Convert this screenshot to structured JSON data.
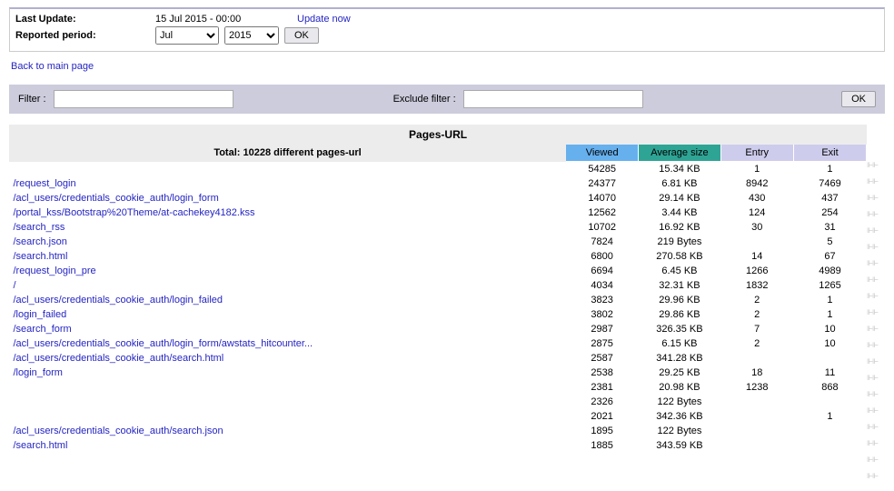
{
  "top": {
    "last_update_label": "Last Update:",
    "last_update_value": "15 Jul 2015 - 00:00",
    "update_now": "Update now",
    "reported_label": "Reported period:",
    "month": "Jul",
    "year": "2015",
    "ok": "OK"
  },
  "back_link": "Back to main page",
  "filter": {
    "filter_label": "Filter :",
    "exclude_label": "Exclude filter :",
    "ok": "OK"
  },
  "table": {
    "title": "Pages-URL",
    "total": "Total: 10228 different pages-url",
    "headers": {
      "viewed": "Viewed",
      "avg": "Average size",
      "entry": "Entry",
      "exit": "Exit"
    },
    "rows": [
      {
        "url": "",
        "viewed": "54285",
        "avg": "15.34 KB",
        "entry": "1",
        "exit": "1"
      },
      {
        "url": "/request_login",
        "viewed": "24377",
        "avg": "6.81 KB",
        "entry": "8942",
        "exit": "7469"
      },
      {
        "url": "/acl_users/credentials_cookie_auth/login_form",
        "viewed": "14070",
        "avg": "29.14 KB",
        "entry": "430",
        "exit": "437"
      },
      {
        "url": "/portal_kss/Bootstrap%20Theme/at-cachekey4182.kss",
        "viewed": "12562",
        "avg": "3.44 KB",
        "entry": "124",
        "exit": "254"
      },
      {
        "url": "/search_rss",
        "viewed": "10702",
        "avg": "16.92 KB",
        "entry": "30",
        "exit": "31"
      },
      {
        "url": "/search.json",
        "viewed": "7824",
        "avg": "219 Bytes",
        "entry": "",
        "exit": "5"
      },
      {
        "url": "/search.html",
        "viewed": "6800",
        "avg": "270.58 KB",
        "entry": "14",
        "exit": "67"
      },
      {
        "url": "/request_login_pre",
        "viewed": "6694",
        "avg": "6.45 KB",
        "entry": "1266",
        "exit": "4989"
      },
      {
        "url": "/",
        "viewed": "4034",
        "avg": "32.31 KB",
        "entry": "1832",
        "exit": "1265"
      },
      {
        "url": "/acl_users/credentials_cookie_auth/login_failed",
        "viewed": "3823",
        "avg": "29.96 KB",
        "entry": "2",
        "exit": "1"
      },
      {
        "url": "/login_failed",
        "viewed": "3802",
        "avg": "29.86 KB",
        "entry": "2",
        "exit": "1"
      },
      {
        "url": "/search_form",
        "viewed": "2987",
        "avg": "326.35 KB",
        "entry": "7",
        "exit": "10"
      },
      {
        "url": "/acl_users/credentials_cookie_auth/login_form/awstats_hitcounter...",
        "viewed": "2875",
        "avg": "6.15 KB",
        "entry": "2",
        "exit": "10"
      },
      {
        "url": "/acl_users/credentials_cookie_auth/search.html",
        "viewed": "2587",
        "avg": "341.28 KB",
        "entry": "",
        "exit": ""
      },
      {
        "url": "/login_form",
        "viewed": "2538",
        "avg": "29.25 KB",
        "entry": "18",
        "exit": "11"
      },
      {
        "url": "",
        "viewed": "2381",
        "avg": "20.98 KB",
        "entry": "1238",
        "exit": "868"
      },
      {
        "url": "",
        "viewed": "2326",
        "avg": "122 Bytes",
        "entry": "",
        "exit": ""
      },
      {
        "url": "",
        "viewed": "2021",
        "avg": "342.36 KB",
        "entry": "",
        "exit": "1"
      },
      {
        "url": "/acl_users/credentials_cookie_auth/search.json",
        "viewed": "1895",
        "avg": "122 Bytes",
        "entry": "",
        "exit": ""
      },
      {
        "url": "/search.html",
        "viewed": "1885",
        "avg": "343.59 KB",
        "entry": "",
        "exit": ""
      }
    ]
  }
}
